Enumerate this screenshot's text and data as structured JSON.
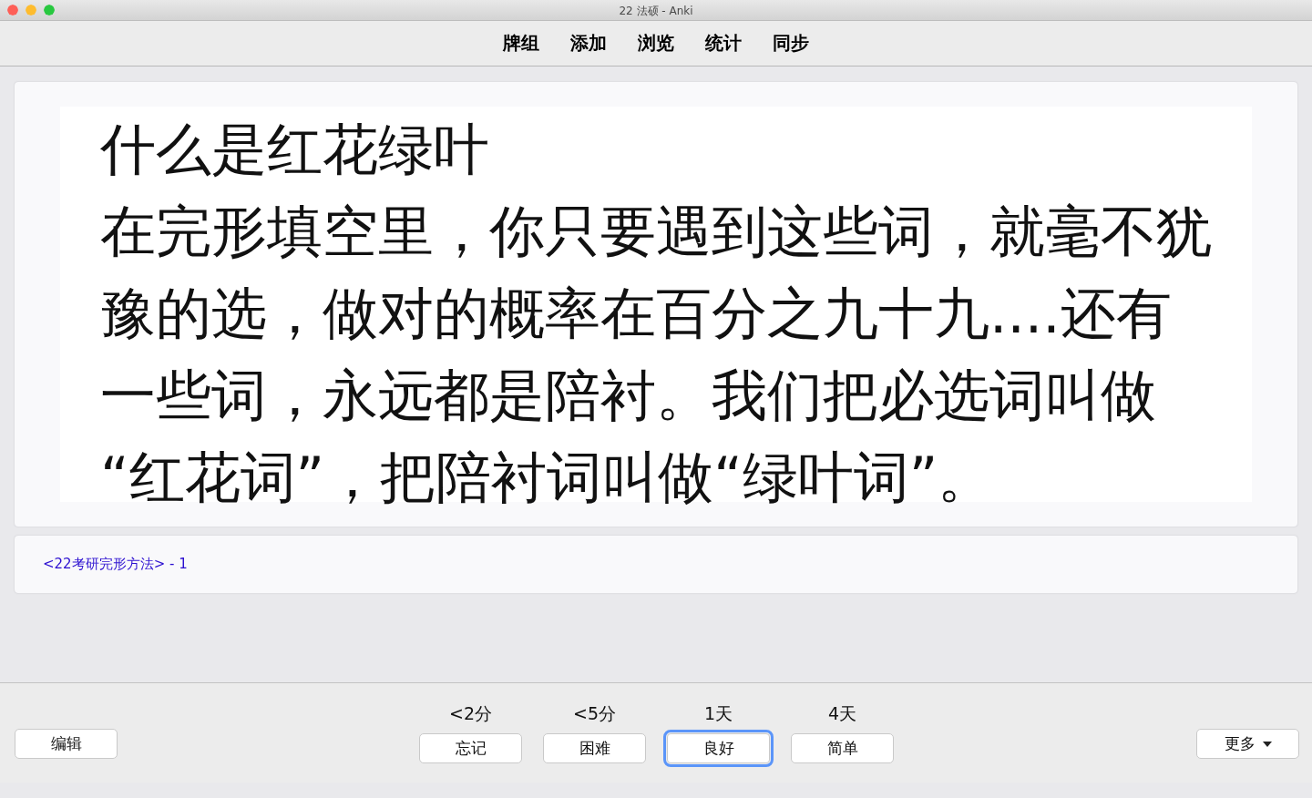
{
  "window": {
    "title": "22 法硕 - Anki"
  },
  "toolbar": [
    {
      "label": "牌组"
    },
    {
      "label": "添加"
    },
    {
      "label": "浏览"
    },
    {
      "label": "统计"
    },
    {
      "label": "同步"
    }
  ],
  "card": {
    "question": "什么是红花绿叶",
    "answer_lines": [
      "在完形填空里，你只要遇到这些词，就毫不犹",
      "豫的选，做对的概率在百分之九十九....还有",
      "一些词，永远都是陪衬。我们把必选词叫做",
      "“红花词”，把陪衬词叫做“绿叶词”。"
    ]
  },
  "info": {
    "text": "<22考研完形方法> - 1"
  },
  "bottom": {
    "edit": "编辑",
    "more": "更多",
    "answers": [
      {
        "interval": "<2分",
        "label": "忘记",
        "selected": false
      },
      {
        "interval": "<5分",
        "label": "困难",
        "selected": false
      },
      {
        "interval": "1天",
        "label": "良好",
        "selected": true
      },
      {
        "interval": "4天",
        "label": "简单",
        "selected": false
      }
    ]
  }
}
